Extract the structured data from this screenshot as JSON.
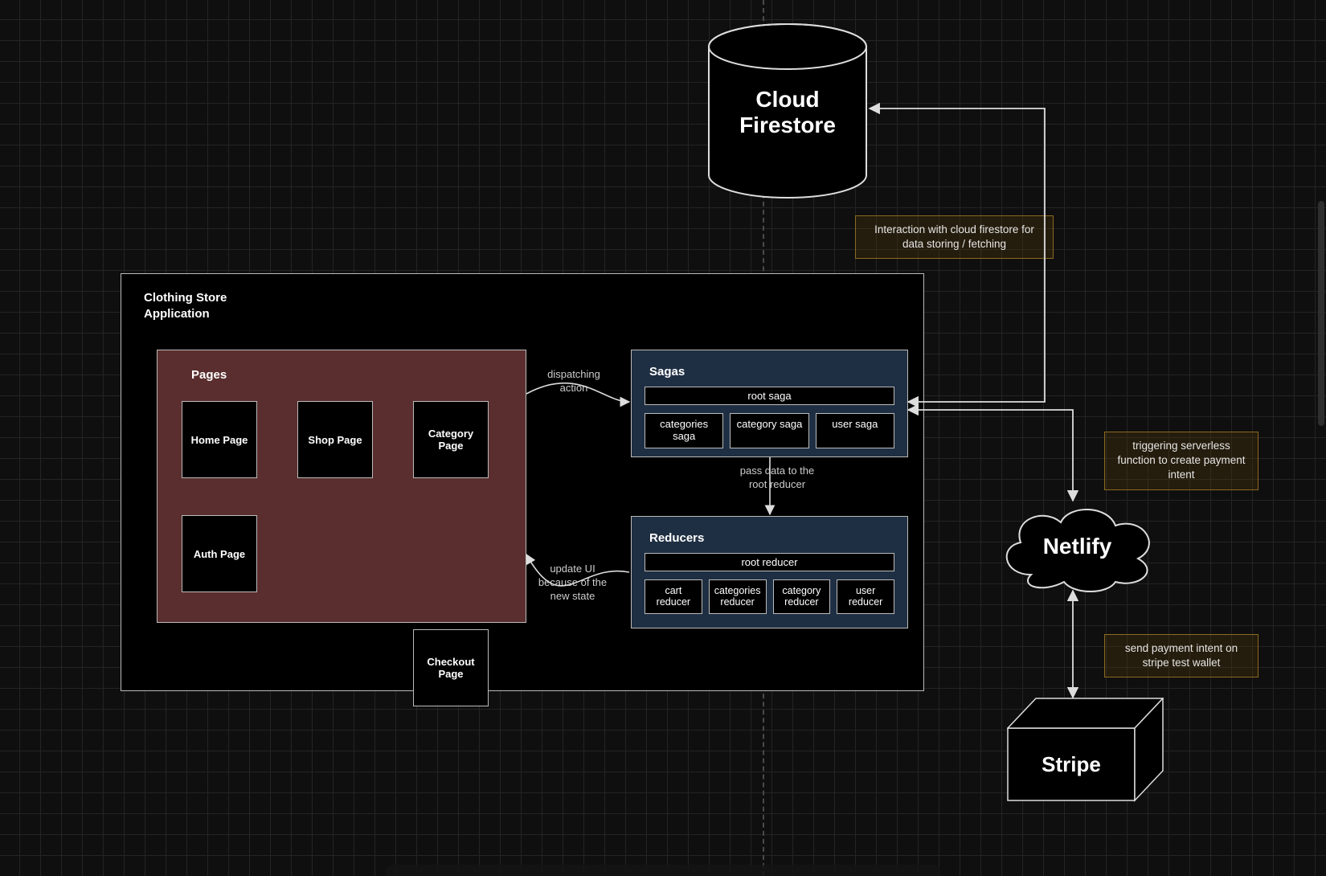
{
  "diagram": {
    "app_box": {
      "title_line1": "Clothing Store",
      "title_line2": "Application"
    },
    "pages": {
      "title": "Pages",
      "items": [
        "Home Page",
        "Shop Page",
        "Category Page",
        "Auth Page",
        "Checkout Page"
      ]
    },
    "sagas": {
      "title": "Sagas",
      "root": "root saga",
      "children": [
        "categories saga",
        "category saga",
        "user saga"
      ]
    },
    "reducers": {
      "title": "Reducers",
      "root": "root reducer",
      "children": [
        "cart reducer",
        "categories reducer",
        "category reducer",
        "user reducer"
      ]
    },
    "nodes": {
      "firestore": "Cloud Firestore",
      "netlify": "Netlify",
      "stripe": "Stripe"
    },
    "edge_labels": {
      "dispatch": "dispatching action",
      "pass_data": "pass data to the root reducer",
      "update_ui": "update UI because of the new state"
    },
    "annotations": {
      "firestore_interaction": "Interaction with cloud firestore for data storing / fetching",
      "trigger_serverless": "triggering serverless function to create payment intent",
      "send_intent": "send payment intent on stripe test wallet"
    }
  }
}
